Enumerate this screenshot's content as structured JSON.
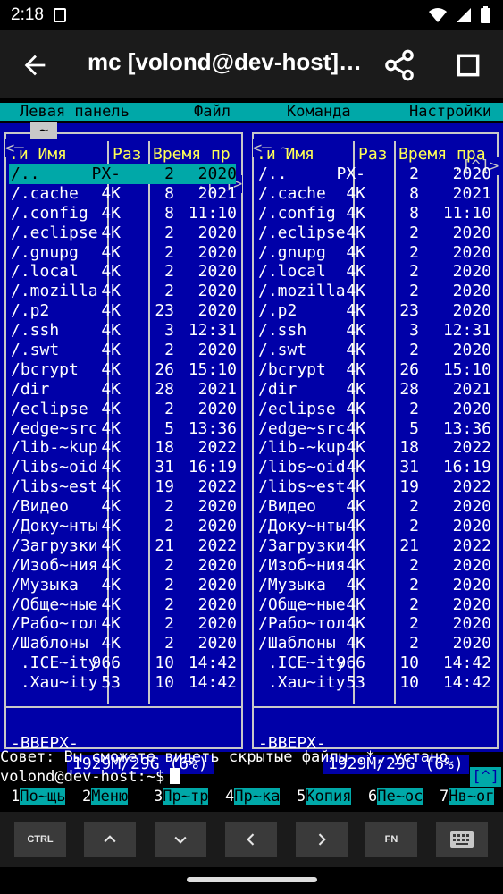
{
  "status_bar": {
    "time": "2:18"
  },
  "app_bar": {
    "title": "mc [volond@dev-host]…"
  },
  "menu": {
    "left": "Левая панель",
    "file": "Файл",
    "command": "Команда",
    "settings": "Настройки"
  },
  "left_panel": {
    "top_left": "<─",
    "tilde": "~",
    "top_right": ".[^]>",
    "headers": {
      "name": ".и Имя",
      "size": "Раз",
      "time": "Время пр"
    },
    "rows": [
      {
        "name": "/..",
        "size": "PX-",
        "d": "2",
        "t": "2020",
        "selected": true
      },
      {
        "name": "/.cache",
        "size": "4K",
        "d": "8",
        "t": "2021"
      },
      {
        "name": "/.config",
        "size": "4K",
        "d": "8",
        "t": "11:10"
      },
      {
        "name": "/.eclipse",
        "size": "4K",
        "d": "2",
        "t": "2020"
      },
      {
        "name": "/.gnupg",
        "size": "4K",
        "d": "2",
        "t": "2020"
      },
      {
        "name": "/.local",
        "size": "4K",
        "d": "2",
        "t": "2020"
      },
      {
        "name": "/.mozilla",
        "size": "4K",
        "d": "2",
        "t": "2020"
      },
      {
        "name": "/.p2",
        "size": "4K",
        "d": "23",
        "t": "2020"
      },
      {
        "name": "/.ssh",
        "size": "4K",
        "d": "3",
        "t": "12:31"
      },
      {
        "name": "/.swt",
        "size": "4K",
        "d": "2",
        "t": "2020"
      },
      {
        "name": "/bcrypt",
        "size": "4K",
        "d": "26",
        "t": "15:10"
      },
      {
        "name": "/dir",
        "size": "4K",
        "d": "28",
        "t": "2021"
      },
      {
        "name": "/eclipse",
        "size": "4K",
        "d": "2",
        "t": "2020"
      },
      {
        "name": "/edge~src",
        "size": "4K",
        "d": "5",
        "t": "13:36"
      },
      {
        "name": "/lib-~kup",
        "size": "4K",
        "d": "18",
        "t": "2022"
      },
      {
        "name": "/libs~oid",
        "size": "4K",
        "d": "31",
        "t": "16:19"
      },
      {
        "name": "/libs~est",
        "size": "4K",
        "d": "19",
        "t": "2022"
      },
      {
        "name": "/Видео",
        "size": "4K",
        "d": "2",
        "t": "2020"
      },
      {
        "name": "/Доку~нты",
        "size": "4K",
        "d": "2",
        "t": "2020"
      },
      {
        "name": "/Загрузки",
        "size": "4K",
        "d": "21",
        "t": "2022"
      },
      {
        "name": "/Изоб~ния",
        "size": "4K",
        "d": "2",
        "t": "2020"
      },
      {
        "name": "/Музыка",
        "size": "4K",
        "d": "2",
        "t": "2020"
      },
      {
        "name": "/Обще~ные",
        "size": "4K",
        "d": "2",
        "t": "2020"
      },
      {
        "name": "/Рабо~тол",
        "size": "4K",
        "d": "2",
        "t": "2020"
      },
      {
        "name": "/Шаблоны",
        "size": "4K",
        "d": "2",
        "t": "2020"
      },
      {
        "name": " .ICE~ity",
        "size": "966",
        "d": "10",
        "t": "14:42"
      },
      {
        "name": " .Xau~ity",
        "size": "53",
        "d": "10",
        "t": "14:42"
      }
    ],
    "status": "-ВВЕРХ-",
    "disk": "1929M/29G (6%)"
  },
  "right_panel": {
    "top_left": "<─ ~",
    "top_right": ".[^]>",
    "headers": {
      "name": ".и Имя",
      "size": "Раз",
      "time": "Время пра"
    },
    "rows": [
      {
        "name": "/..",
        "size": "PX-",
        "d": "2",
        "t": "2020"
      },
      {
        "name": "/.cache",
        "size": "4K",
        "d": "8",
        "t": "2021"
      },
      {
        "name": "/.config",
        "size": "4K",
        "d": "8",
        "t": "11:10"
      },
      {
        "name": "/.eclipse",
        "size": "4K",
        "d": "2",
        "t": "2020"
      },
      {
        "name": "/.gnupg",
        "size": "4K",
        "d": "2",
        "t": "2020"
      },
      {
        "name": "/.local",
        "size": "4K",
        "d": "2",
        "t": "2020"
      },
      {
        "name": "/.mozilla",
        "size": "4K",
        "d": "2",
        "t": "2020"
      },
      {
        "name": "/.p2",
        "size": "4K",
        "d": "23",
        "t": "2020"
      },
      {
        "name": "/.ssh",
        "size": "4K",
        "d": "3",
        "t": "12:31"
      },
      {
        "name": "/.swt",
        "size": "4K",
        "d": "2",
        "t": "2020"
      },
      {
        "name": "/bcrypt",
        "size": "4K",
        "d": "26",
        "t": "15:10"
      },
      {
        "name": "/dir",
        "size": "4K",
        "d": "28",
        "t": "2021"
      },
      {
        "name": "/eclipse",
        "size": "4K",
        "d": "2",
        "t": "2020"
      },
      {
        "name": "/edge~src",
        "size": "4K",
        "d": "5",
        "t": "13:36"
      },
      {
        "name": "/lib-~kup",
        "size": "4K",
        "d": "18",
        "t": "2022"
      },
      {
        "name": "/libs~oid",
        "size": "4K",
        "d": "31",
        "t": "16:19"
      },
      {
        "name": "/libs~est",
        "size": "4K",
        "d": "19",
        "t": "2022"
      },
      {
        "name": "/Видео",
        "size": "4K",
        "d": "2",
        "t": "2020"
      },
      {
        "name": "/Доку~нты",
        "size": "4K",
        "d": "2",
        "t": "2020"
      },
      {
        "name": "/Загрузки",
        "size": "4K",
        "d": "21",
        "t": "2022"
      },
      {
        "name": "/Изоб~ния",
        "size": "4K",
        "d": "2",
        "t": "2020"
      },
      {
        "name": "/Музыка",
        "size": "4K",
        "d": "2",
        "t": "2020"
      },
      {
        "name": "/Обще~ные",
        "size": "4K",
        "d": "2",
        "t": "2020"
      },
      {
        "name": "/Рабо~тол",
        "size": "4K",
        "d": "2",
        "t": "2020"
      },
      {
        "name": "/Шаблоны",
        "size": "4K",
        "d": "2",
        "t": "2020"
      },
      {
        "name": " .ICE~ity",
        "size": "966",
        "d": "10",
        "t": "14:42"
      },
      {
        "name": " .Xau~ity",
        "size": "53",
        "d": "10",
        "t": "14:42"
      }
    ],
    "status": "-ВВЕРХ-",
    "disk": "1929M/29G (6%)"
  },
  "hint": "Совет: Вы сможете видеть скрытые файлы .*, устано",
  "prompt": "volond@dev-host:~$",
  "prompt_bracket": "[^]",
  "fkeys": [
    {
      "n": "1",
      "label": "По~щь"
    },
    {
      "n": "2",
      "label": "Меню"
    },
    {
      "n": "3",
      "label": "Пр~тр"
    },
    {
      "n": "4",
      "label": "Пр~ка"
    },
    {
      "n": "5",
      "label": "Копия"
    },
    {
      "n": "6",
      "label": "Пе~ос"
    },
    {
      "n": "7",
      "label": "Нв~ог"
    }
  ],
  "extra_keys": {
    "ctrl": "CTRL",
    "fn": "FN"
  },
  "icons": [
    "back-arrow-icon",
    "share-icon",
    "window-icon",
    "wifi-icon",
    "signal-icon",
    "battery-icon",
    "sim-icon",
    "chevron-up-icon",
    "chevron-down-icon",
    "chevron-left-icon",
    "chevron-right-icon",
    "keyboard-icon"
  ]
}
